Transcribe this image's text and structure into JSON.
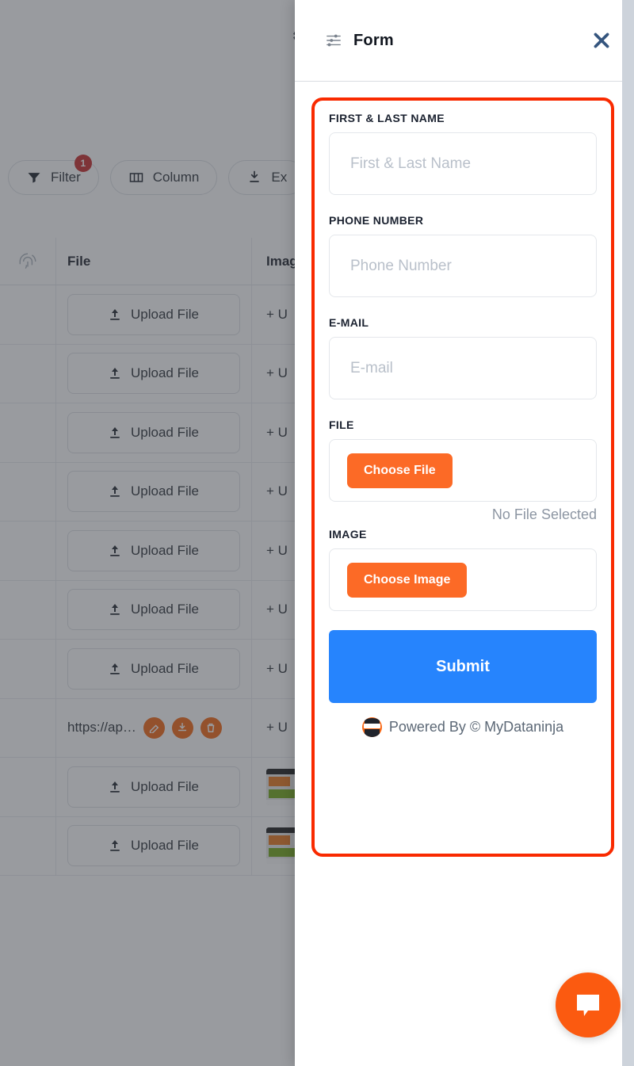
{
  "background": {
    "topbar": {
      "settings_icon": "gear-icon"
    },
    "toolbar": {
      "filter_label": "Filter",
      "filter_badge": "1",
      "column_label": "Column",
      "export_label": "Ex"
    },
    "table": {
      "headers": {
        "select": "",
        "file": "File",
        "image": "Imag"
      },
      "rows": [
        {
          "file": "Upload File",
          "image": "+ U",
          "type": "upload",
          "thumb": false
        },
        {
          "file": "Upload File",
          "image": "+ U",
          "type": "upload",
          "thumb": false
        },
        {
          "file": "Upload File",
          "image": "+ U",
          "type": "upload",
          "thumb": false
        },
        {
          "file": "Upload File",
          "image": "+ U",
          "type": "upload",
          "thumb": false
        },
        {
          "file": "Upload File",
          "image": "+ U",
          "type": "upload",
          "thumb": false
        },
        {
          "file": "Upload File",
          "image": "+ U",
          "type": "upload",
          "thumb": false
        },
        {
          "file": "Upload File",
          "image": "+ U",
          "type": "upload",
          "thumb": false
        },
        {
          "file": "https://ap…",
          "image": "+ U",
          "type": "link",
          "thumb": false
        },
        {
          "file": "Upload File",
          "image": "",
          "type": "upload",
          "thumb": true
        },
        {
          "file": "Upload File",
          "image": "",
          "type": "upload",
          "thumb": true
        }
      ]
    }
  },
  "panel": {
    "title": "Form",
    "header_icon": "sliders-icon",
    "close_icon": "close-icon",
    "fields": [
      {
        "label": "FIRST & LAST NAME",
        "placeholder": "First & Last Name",
        "value": "",
        "kind": "text"
      },
      {
        "label": "PHONE NUMBER",
        "placeholder": "Phone Number",
        "value": "",
        "kind": "text"
      },
      {
        "label": "E-MAIL",
        "placeholder": "E-mail",
        "value": "",
        "kind": "text"
      }
    ],
    "file_field": {
      "label": "FILE",
      "button_label": "Choose File",
      "status": "No File Selected"
    },
    "image_field": {
      "label": "IMAGE",
      "button_label": "Choose Image"
    },
    "submit_label": "Submit",
    "footer": {
      "text": "Powered By © MyDataninja",
      "logo_icon": "mydataninja-ninja-icon"
    }
  },
  "chat": {
    "icon": "chat-bubble-icon"
  },
  "colors": {
    "orange": "#fc6a26",
    "blue": "#2684fd",
    "highlight_red": "#f92a00",
    "badge_red": "#c62828",
    "label_navy": "#1b2230",
    "placeholder_gray": "#b9c0ca"
  }
}
